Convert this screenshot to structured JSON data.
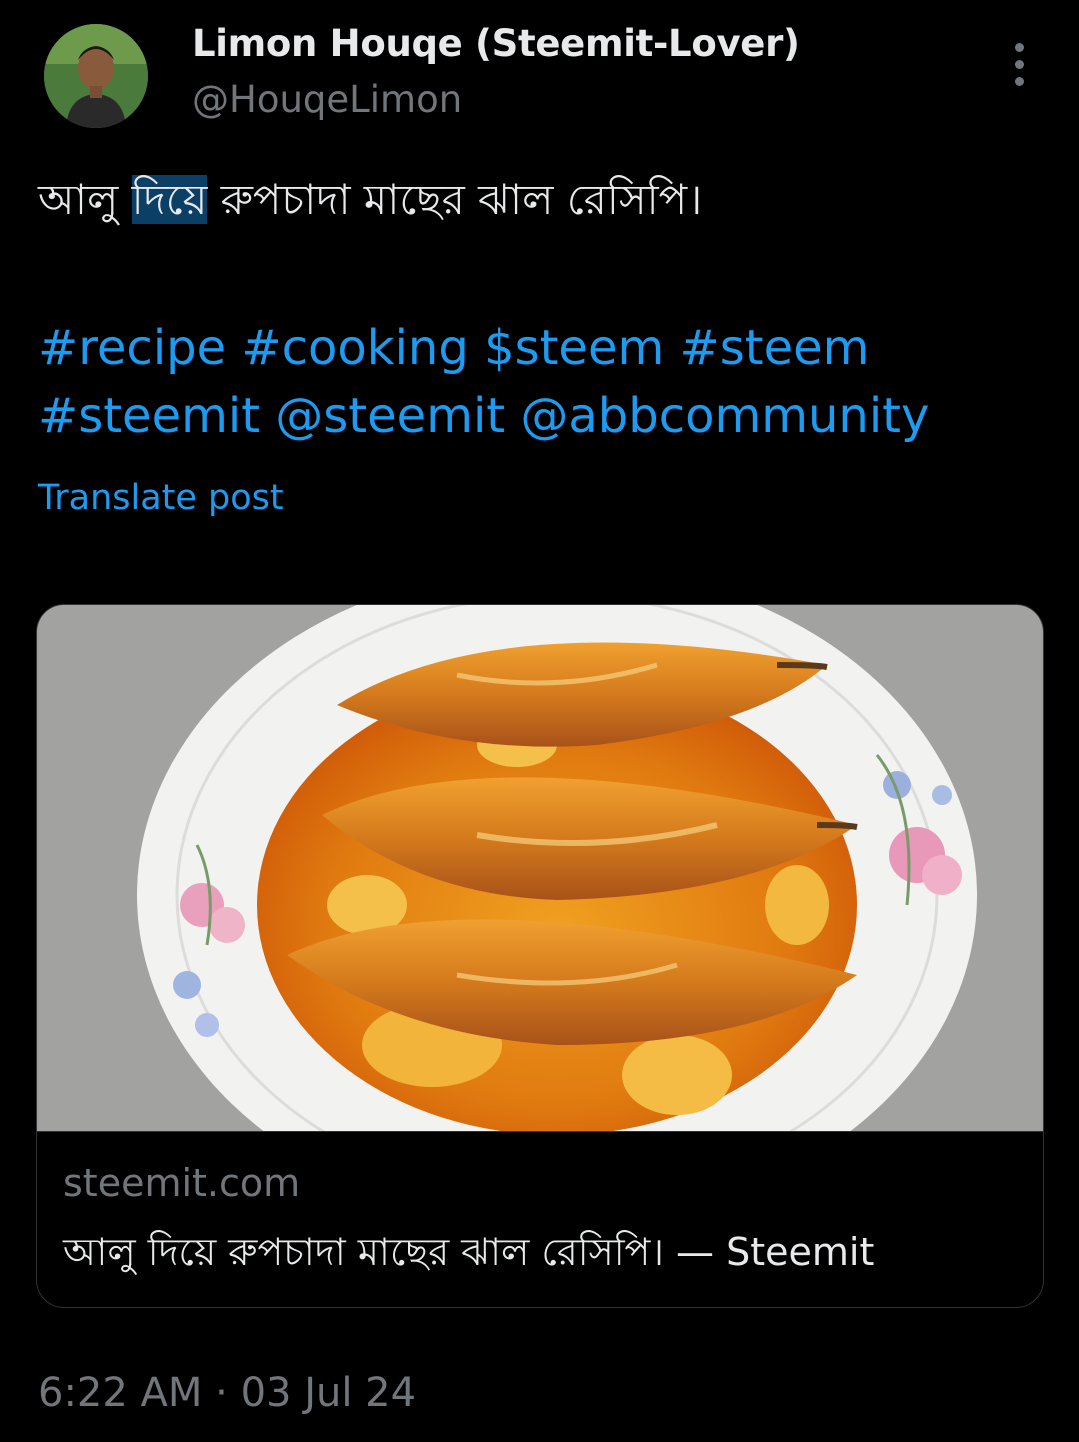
{
  "post": {
    "author": {
      "display_name": "Limon Houqe (Steemit-Lover)",
      "handle": "@HouqeLimon",
      "avatar_icon": "profile-photo"
    },
    "text_before": "আলু ",
    "text_highlight": "দিয়ে",
    "text_after": " রুপচাদা মাছের ঝাল রেসিপি।",
    "tags": [
      "#recipe",
      "#cooking",
      "$steem",
      "#steem",
      "#steemit",
      "@steemit",
      "@abbcommunity"
    ],
    "translate_label": "Translate post",
    "more_icon": "more-vertical-icon"
  },
  "card": {
    "domain": "steemit.com",
    "title": "আলু দিয়ে রুপচাদা মাছের ঝাল রেসিপি। — Steemit",
    "image_icon": "fish-curry-photo"
  },
  "meta": {
    "time": "6:22 AM",
    "separator": " · ",
    "date": "03 Jul 24"
  },
  "colors": {
    "background": "#000000",
    "text_primary": "#e7e9ea",
    "text_secondary": "#71767b",
    "link": "#1d9bf0",
    "highlight": "#0b3f66",
    "border": "#2f3336"
  }
}
